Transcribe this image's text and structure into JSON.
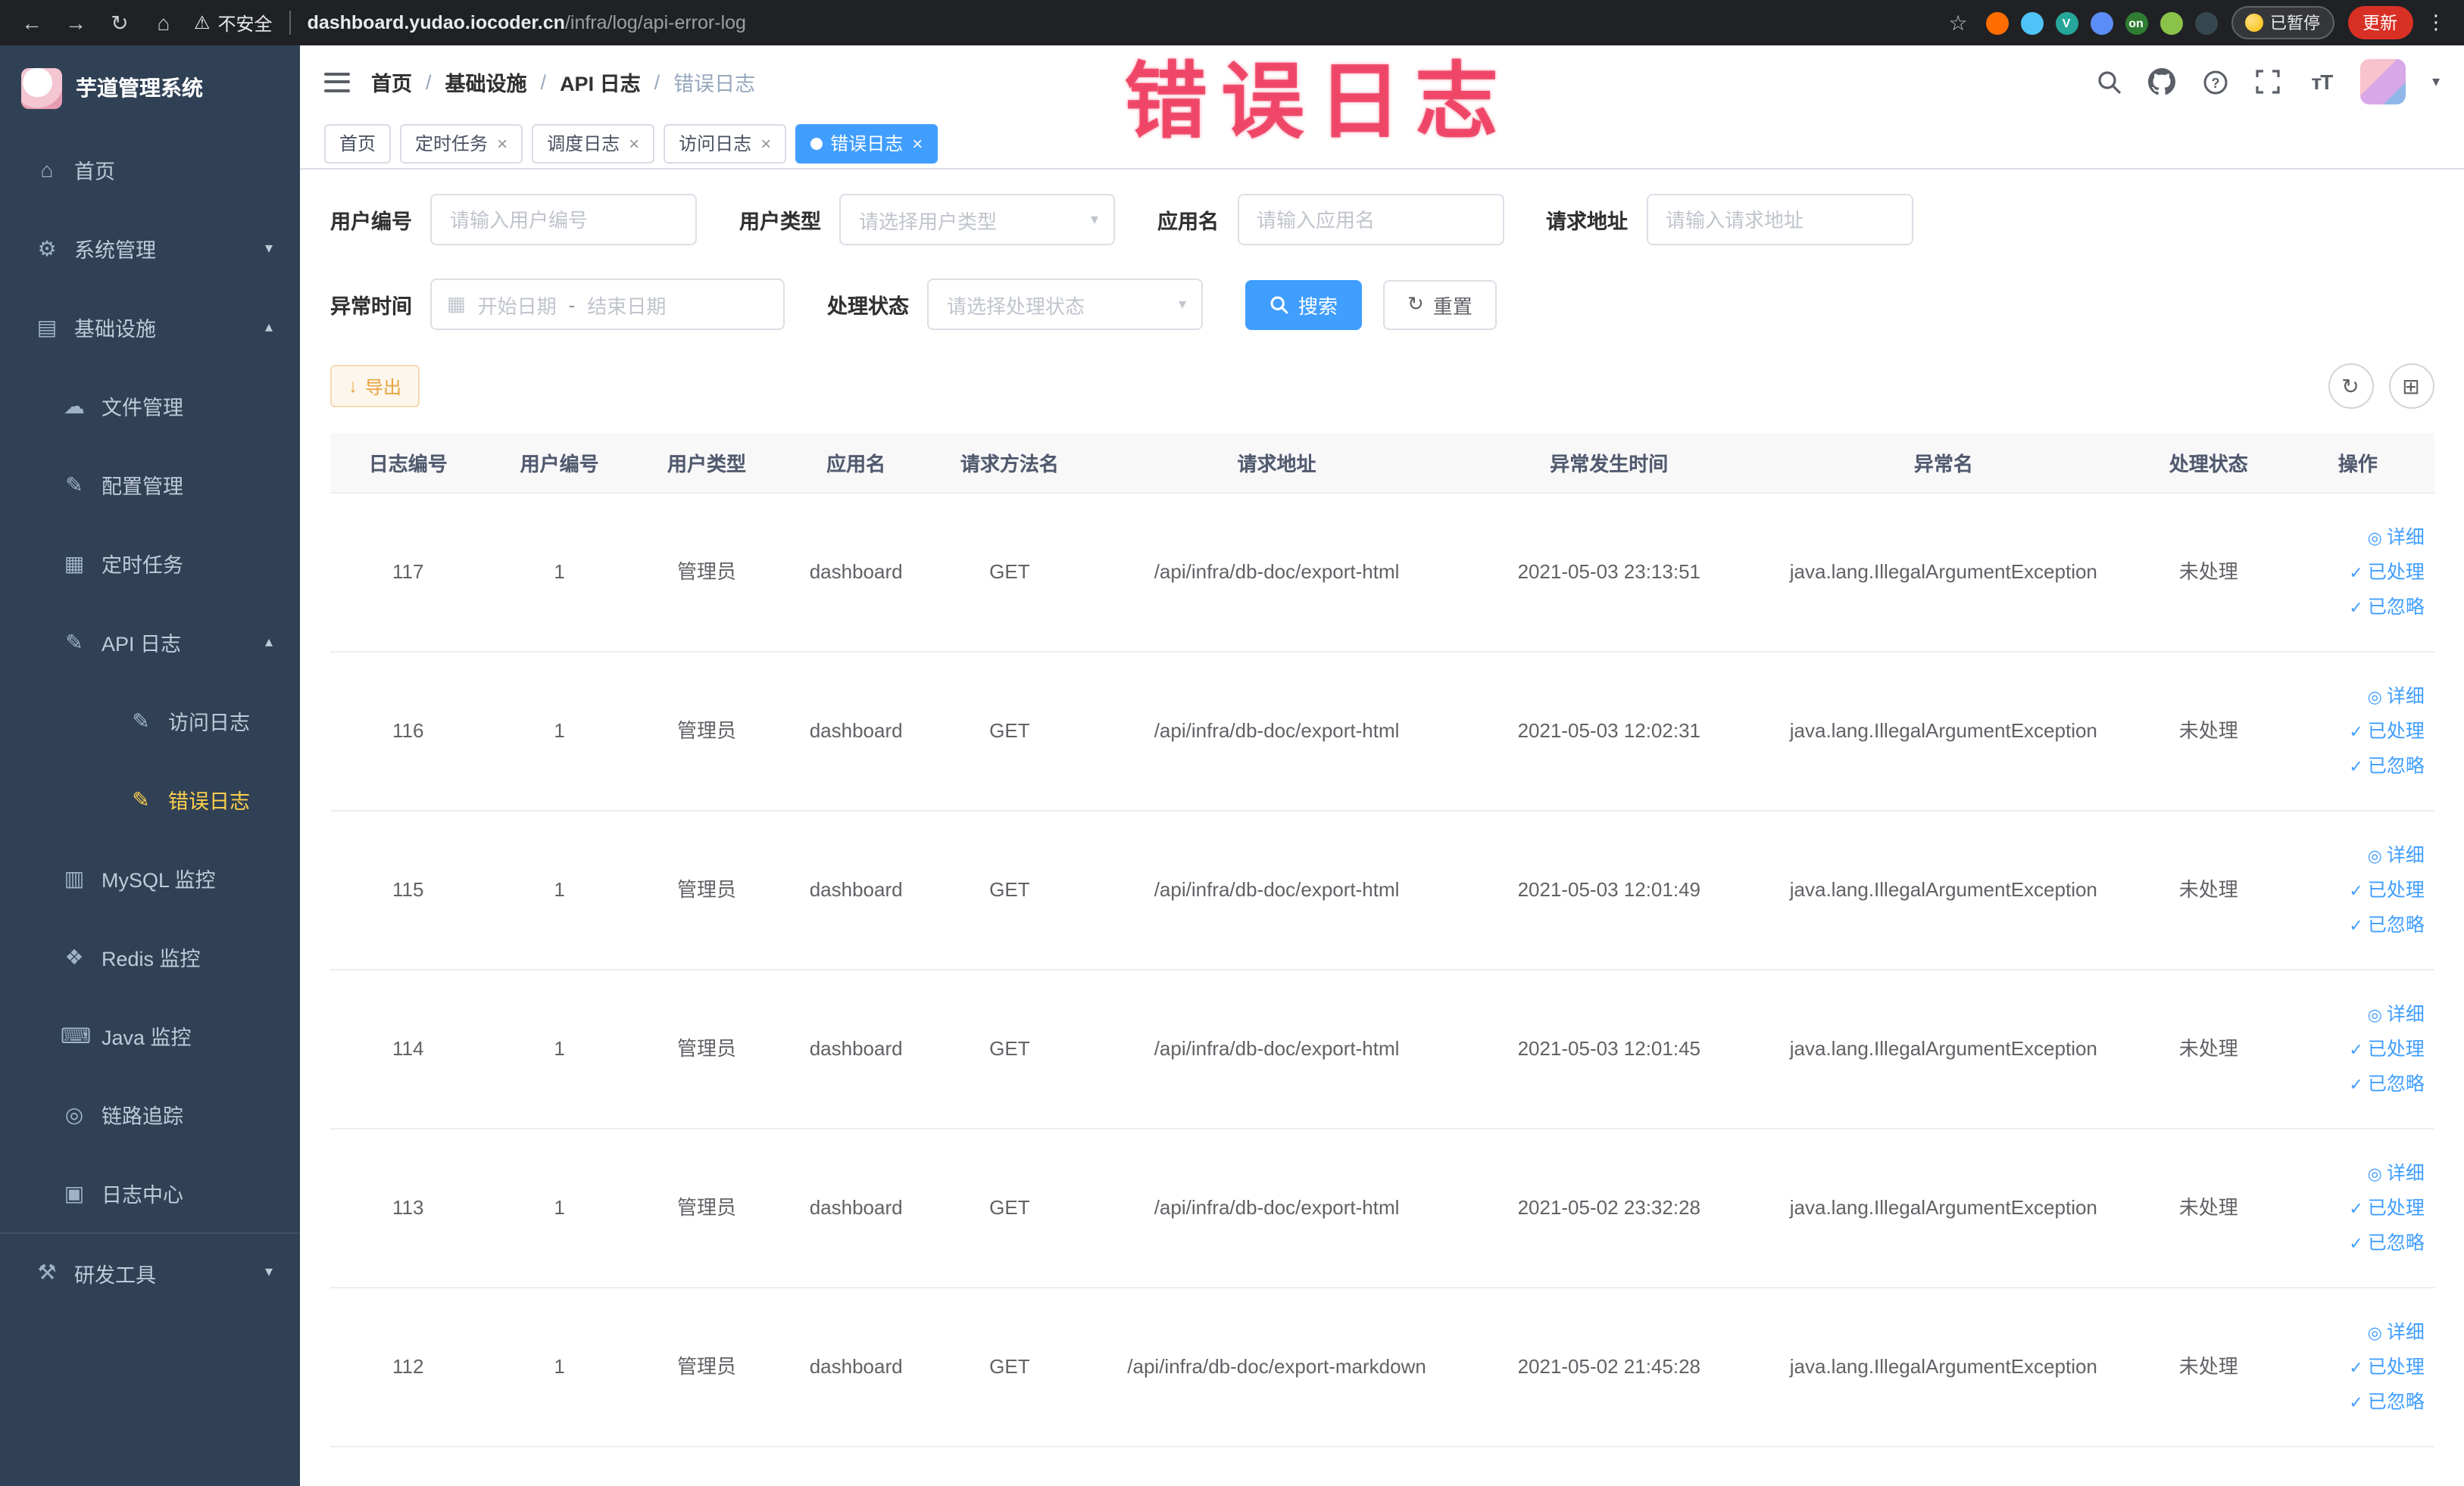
{
  "browser": {
    "security_label": "不安全",
    "url_host": "dashboard.yudao.iocoder.cn",
    "url_path": "/infra/log/api-error-log",
    "paused_badge": "已暂停",
    "update_label": "更新",
    "extensions": [
      {
        "name": "ext-orange-icon",
        "color": "#ff6d00",
        "label": ""
      },
      {
        "name": "ext-drop-icon",
        "color": "#4fc3f7",
        "label": ""
      },
      {
        "name": "ext-green-v-icon",
        "color": "#26a69a",
        "label": "V"
      },
      {
        "name": "ext-blue-grid-icon",
        "color": "#5c8df6",
        "label": ""
      },
      {
        "name": "ext-onetab-icon",
        "color": "#2e7d32",
        "label": "on"
      },
      {
        "name": "ext-leaf-icon",
        "color": "#8bc34a",
        "label": ""
      },
      {
        "name": "ext-paw-icon",
        "color": "#37474f",
        "label": ""
      }
    ]
  },
  "annotation": {
    "text": "错误日志"
  },
  "sidebar": {
    "logo_title": "芋道管理系统",
    "menu": [
      {
        "label": "首页",
        "icon": "home-icon",
        "level": 1
      },
      {
        "label": "系统管理",
        "icon": "gear-icon",
        "level": 1,
        "chevron": "down"
      },
      {
        "label": "基础设施",
        "icon": "infra-icon",
        "level": 1,
        "chevron": "up"
      },
      {
        "label": "文件管理",
        "icon": "file-icon",
        "level": 2
      },
      {
        "label": "配置管理",
        "icon": "config-icon",
        "level": 2
      },
      {
        "label": "定时任务",
        "icon": "cron-icon",
        "level": 2
      },
      {
        "label": "API 日志",
        "icon": "api-log-icon",
        "level": 2,
        "chevron": "up"
      },
      {
        "label": "访问日志",
        "icon": "access-log-icon",
        "level": 3
      },
      {
        "label": "错误日志",
        "icon": "error-log-icon",
        "level": 3,
        "active": true
      },
      {
        "label": "MySQL 监控",
        "icon": "mysql-icon",
        "level": 2
      },
      {
        "label": "Redis 监控",
        "icon": "redis-icon",
        "level": 2
      },
      {
        "label": "Java 监控",
        "icon": "java-icon",
        "level": 2
      },
      {
        "label": "链路追踪",
        "icon": "trace-icon",
        "level": 2
      },
      {
        "label": "日志中心",
        "icon": "log-center-icon",
        "level": 2
      },
      {
        "label": "研发工具",
        "icon": "devtools-icon",
        "level": 1,
        "chevron": "down",
        "sep": true
      }
    ]
  },
  "header": {
    "breadcrumb": [
      "首页",
      "基础设施",
      "API 日志",
      "错误日志"
    ],
    "breadcrumb_separator": "/"
  },
  "tabs": [
    {
      "label": "首页",
      "closable": false,
      "active": false
    },
    {
      "label": "定时任务",
      "closable": true,
      "active": false
    },
    {
      "label": "调度日志",
      "closable": true,
      "active": false
    },
    {
      "label": "访问日志",
      "closable": true,
      "active": false
    },
    {
      "label": "错误日志",
      "closable": true,
      "active": true
    }
  ],
  "filters": {
    "user_id": {
      "label": "用户编号",
      "placeholder": "请输入用户编号",
      "value": ""
    },
    "user_type": {
      "label": "用户类型",
      "placeholder": "请选择用户类型"
    },
    "app_name": {
      "label": "应用名",
      "placeholder": "请输入应用名",
      "value": ""
    },
    "request_url": {
      "label": "请求地址",
      "placeholder": "请输入请求地址",
      "value": ""
    },
    "exception_time": {
      "label": "异常时间",
      "start_placeholder": "开始日期",
      "separator": "-",
      "end_placeholder": "结束日期"
    },
    "process_status": {
      "label": "处理状态",
      "placeholder": "请选择处理状态"
    },
    "search_label": "搜索",
    "reset_label": "重置"
  },
  "toolbar": {
    "export_label": "导出"
  },
  "table": {
    "columns": [
      "日志编号",
      "用户编号",
      "用户类型",
      "应用名",
      "请求方法名",
      "请求地址",
      "异常发生时间",
      "异常名",
      "处理状态",
      "操作"
    ],
    "actions": [
      "详细",
      "已处理",
      "已忽略"
    ],
    "rows": [
      {
        "id": "117",
        "user_id": "1",
        "user_type": "管理员",
        "app": "dashboard",
        "method": "GET",
        "url": "/api/infra/db-doc/export-html",
        "time": "2021-05-03 23:13:51",
        "exception": "java.lang.IllegalArgumentException",
        "status": "未处理"
      },
      {
        "id": "116",
        "user_id": "1",
        "user_type": "管理员",
        "app": "dashboard",
        "method": "GET",
        "url": "/api/infra/db-doc/export-html",
        "time": "2021-05-03 12:02:31",
        "exception": "java.lang.IllegalArgumentException",
        "status": "未处理"
      },
      {
        "id": "115",
        "user_id": "1",
        "user_type": "管理员",
        "app": "dashboard",
        "method": "GET",
        "url": "/api/infra/db-doc/export-html",
        "time": "2021-05-03 12:01:49",
        "exception": "java.lang.IllegalArgumentException",
        "status": "未处理"
      },
      {
        "id": "114",
        "user_id": "1",
        "user_type": "管理员",
        "app": "dashboard",
        "method": "GET",
        "url": "/api/infra/db-doc/export-html",
        "time": "2021-05-03 12:01:45",
        "exception": "java.lang.IllegalArgumentException",
        "status": "未处理"
      },
      {
        "id": "113",
        "user_id": "1",
        "user_type": "管理员",
        "app": "dashboard",
        "method": "GET",
        "url": "/api/infra/db-doc/export-html",
        "time": "2021-05-02 23:32:28",
        "exception": "java.lang.IllegalArgumentException",
        "status": "未处理"
      },
      {
        "id": "112",
        "user_id": "1",
        "user_type": "管理员",
        "app": "dashboard",
        "method": "GET",
        "url": "/api/infra/db-doc/export-markdown",
        "time": "2021-05-02 21:45:28",
        "exception": "java.lang.IllegalArgumentException",
        "status": "未处理"
      }
    ]
  },
  "colors": {
    "accent": "#409eff",
    "active_menu": "#ffd04b",
    "warning": "#e6a23c",
    "annotation": "#ee3b5f"
  }
}
